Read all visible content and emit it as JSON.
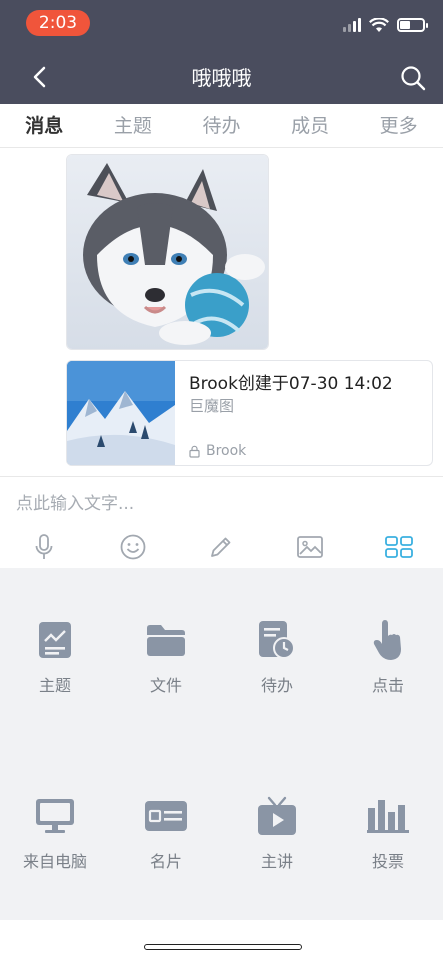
{
  "status_bar": {
    "time": "2:03"
  },
  "header": {
    "title": "哦哦哦"
  },
  "tabs": [
    {
      "label": "消息",
      "active": true
    },
    {
      "label": "主题",
      "active": false
    },
    {
      "label": "待办",
      "active": false
    },
    {
      "label": "成员",
      "active": false
    },
    {
      "label": "更多",
      "active": false
    }
  ],
  "messages": {
    "card": {
      "title": "Brook创建于07-30 14:02",
      "subtitle": "巨魔图",
      "author": "Brook"
    }
  },
  "composer": {
    "placeholder": "点此输入文字...",
    "tools": [
      "microphone-icon",
      "emoji-icon",
      "pencil-icon",
      "image-icon",
      "grid-icon"
    ]
  },
  "panel": {
    "items": [
      {
        "label": "主题",
        "icon": "topic-icon"
      },
      {
        "label": "文件",
        "icon": "folder-icon"
      },
      {
        "label": "待办",
        "icon": "todo-icon"
      },
      {
        "label": "点击",
        "icon": "tap-icon"
      },
      {
        "label": "来自电脑",
        "icon": "monitor-icon"
      },
      {
        "label": "名片",
        "icon": "card-icon"
      },
      {
        "label": "主讲",
        "icon": "tv-icon"
      },
      {
        "label": "投票",
        "icon": "vote-icon"
      }
    ]
  },
  "colors": {
    "header_bg": "#4a4d5e",
    "time_badge": "#f0553b",
    "accent": "#3bb0e0",
    "panel_icon": "#8a95a5"
  }
}
